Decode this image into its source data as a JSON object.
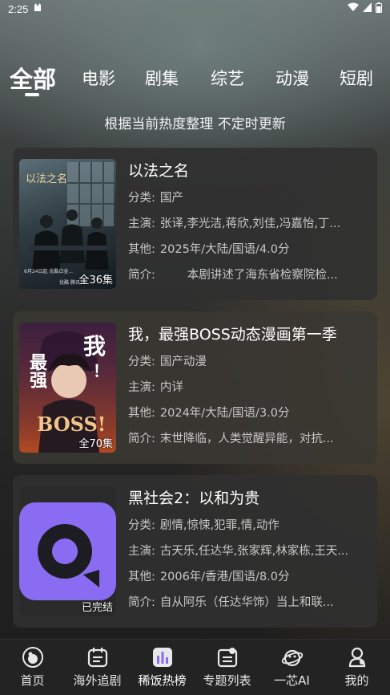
{
  "status_bar": {
    "time": "2:25"
  },
  "category_tabs": [
    {
      "label": "全部",
      "active": true
    },
    {
      "label": "电影",
      "active": false
    },
    {
      "label": "剧集",
      "active": false
    },
    {
      "label": "综艺",
      "active": false
    },
    {
      "label": "动漫",
      "active": false
    },
    {
      "label": "短剧",
      "active": false
    }
  ],
  "subtitle": "根据当前热度整理 不定时更新",
  "field_labels": {
    "genre": "分类:",
    "cast": "主演:",
    "other": "其他:",
    "intro": "简介:"
  },
  "items": [
    {
      "title": "以法之名",
      "badge": "全36集",
      "genre": "国产",
      "cast": "张译,李光洁,蒋欣,刘佳,冯嘉怡,丁...",
      "other": "2025年/大陆/国语/4.0分",
      "intro": "本剧讲述了海东省检察院检...",
      "poster_caption": "6月24日起 优酷白金...",
      "poster_logo": "优酷 腾讯TV",
      "poster_title_art": "以法之名"
    },
    {
      "title": "我，最强BOSS动态漫画第一季",
      "badge": "全70集",
      "genre": "国产动漫",
      "cast": "内详",
      "other": "2024年/大陆/国语/3.0分",
      "intro": "末世降临，人类觉醒异能，对抗...",
      "poster_text_1": "我",
      "poster_text_2": "！",
      "poster_text_3": "最强",
      "poster_text_4": "BOSS!"
    },
    {
      "title": "黑社会2：以和为贵",
      "badge": "已完结",
      "genre": "剧情,惊悚,犯罪,情,动作",
      "cast": "古天乐,任达华,张家辉,林家栋,王天...",
      "other": "2006年/香港/国语/8.0分",
      "intro": "自从阿乐（任达华饰）当上和联..."
    }
  ],
  "bottom_nav": [
    {
      "label": "首页",
      "icon": "home-icon",
      "active": false
    },
    {
      "label": "海外追剧",
      "icon": "calendar-icon",
      "active": false
    },
    {
      "label": "稀饭热榜",
      "icon": "chart-icon",
      "active": true
    },
    {
      "label": "专题列表",
      "icon": "list-icon",
      "active": false
    },
    {
      "label": "一芯AI",
      "icon": "ai-planet-icon",
      "active": false
    },
    {
      "label": "我的",
      "icon": "profile-icon",
      "active": false
    }
  ],
  "colors": {
    "accent_purple": "#8a6cf2",
    "card_bg": "#303030",
    "text_secondary": "#c8c8c8"
  }
}
